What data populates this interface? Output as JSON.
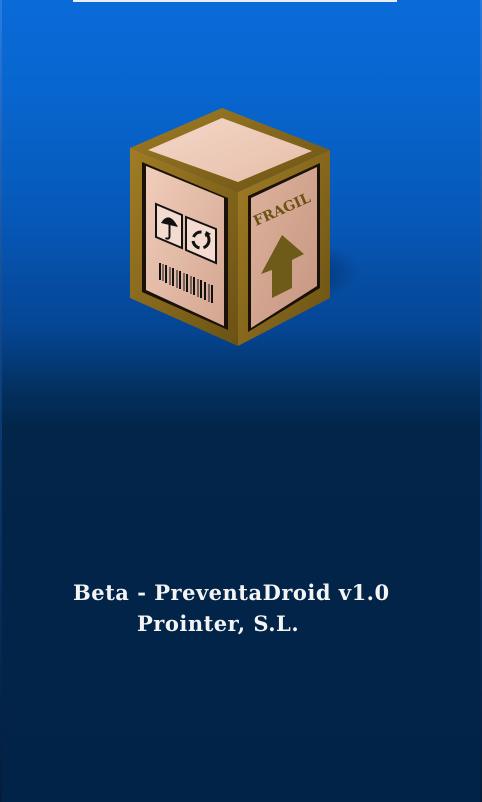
{
  "splash": {
    "logo": {
      "icon": "fragile-box-icon",
      "box_label": "FRAGIL",
      "symbols": [
        "umbrella-icon",
        "recycle-icon",
        "barcode-icon",
        "up-arrow-icon"
      ]
    },
    "version_text": "Beta - PreventaDroid v1.0",
    "company_text": "Prointer, S.L."
  },
  "colors": {
    "background_top": "#0a6ad8",
    "background_bottom": "#022348",
    "box_frame": "#8a6a1c",
    "box_face": "#e3b9a4",
    "text": "#f4f4f4"
  }
}
